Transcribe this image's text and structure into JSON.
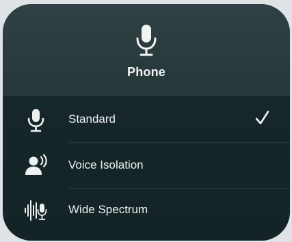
{
  "header": {
    "icon": "microphone-icon",
    "title": "Phone"
  },
  "modes": [
    {
      "label": "Standard",
      "icon": "microphone-icon",
      "selected": true
    },
    {
      "label": "Voice Isolation",
      "icon": "voice-isolation-icon",
      "selected": false
    },
    {
      "label": "Wide Spectrum",
      "icon": "wide-spectrum-icon",
      "selected": false
    }
  ],
  "colors": {
    "text": "#eef1f1",
    "panel_top": "#2f4144",
    "panel_bottom": "#132326"
  }
}
